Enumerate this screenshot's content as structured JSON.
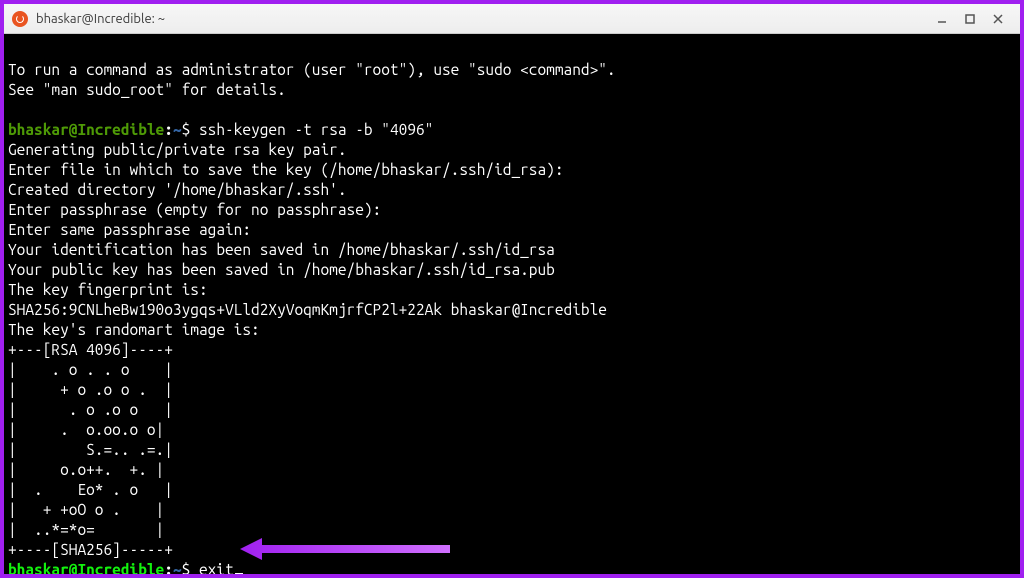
{
  "titlebar": {
    "title": "bhaskar@Incredible: ~"
  },
  "prompt": {
    "userhost": "bhaskar@Incredible",
    "colon": ":",
    "path": "~",
    "dollar": "$"
  },
  "term": {
    "line0": "To run a command as administrator (user \"root\"), use \"sudo <command>\".",
    "line1": "See \"man sudo_root\" for details.",
    "blank": "",
    "cmd1": " ssh-keygen -t rsa -b \"4096\"",
    "out01": "Generating public/private rsa key pair.",
    "out02": "Enter file in which to save the key (/home/bhaskar/.ssh/id_rsa):",
    "out03": "Created directory '/home/bhaskar/.ssh'.",
    "out04": "Enter passphrase (empty for no passphrase):",
    "out05": "Enter same passphrase again:",
    "out06": "Your identification has been saved in /home/bhaskar/.ssh/id_rsa",
    "out07": "Your public key has been saved in /home/bhaskar/.ssh/id_rsa.pub",
    "out08": "The key fingerprint is:",
    "out09": "SHA256:9CNLheBw190o3ygqs+VLld2XyVoqmKmjrfCP2l+22Ak bhaskar@Incredible",
    "out10": "The key's randomart image is:",
    "ra00": "+---[RSA 4096]----+",
    "ra01": "|    . o . . o    |",
    "ra02": "|     + o .o o .  |",
    "ra03": "|      . o .o o   |",
    "ra04": "|     .  o.oo.o o|",
    "ra05": "|        S.=.. .=.|",
    "ra06": "|     o.o++.  +. |",
    "ra07": "|  .    Eo* . o   |",
    "ra08": "|   + +oO o .    |",
    "ra09": "|  ..*=*o=       |",
    "ra10": "+----[SHA256]-----+",
    "cmd2": " exit"
  }
}
